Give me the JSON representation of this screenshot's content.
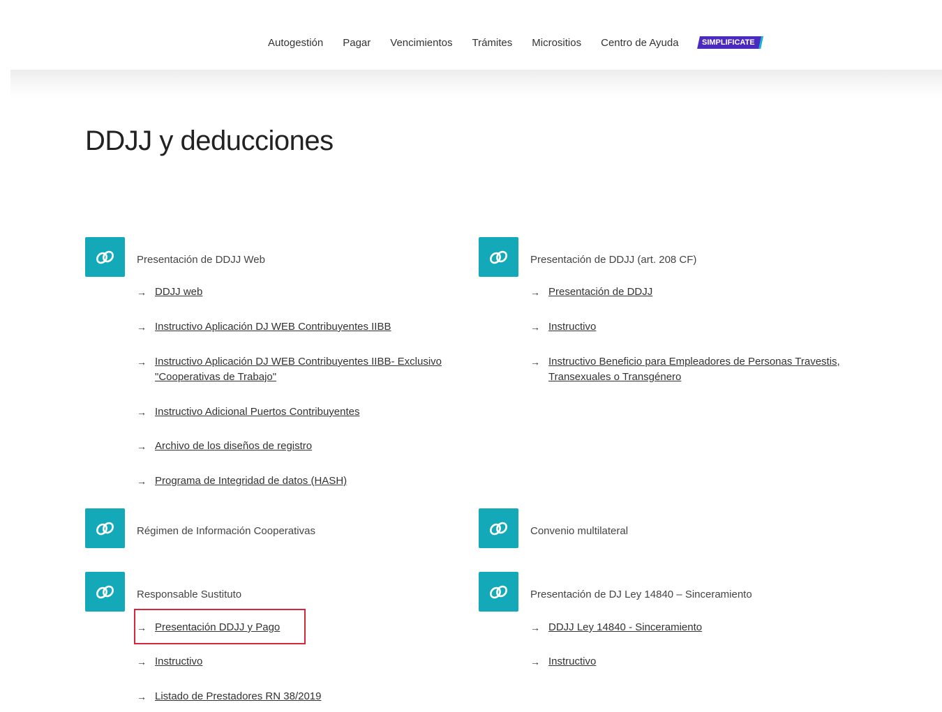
{
  "nav": {
    "items": [
      "Autogestión",
      "Pagar",
      "Vencimientos",
      "Trámites",
      "Micrositios",
      "Centro de Ayuda"
    ],
    "badge": "SIMPLIFICATE"
  },
  "page": {
    "title": "DDJJ y deducciones"
  },
  "sections": [
    {
      "title": "Presentación de DDJJ Web",
      "icon": "link-icon",
      "links": [
        [
          "DDJJ web"
        ],
        [
          "Instructivo Aplicación DJ WEB Contribuyentes IIBB"
        ],
        [
          "Instructivo Aplicación DJ WEB Contribuyentes IIBB- Exclusivo",
          "\"Cooperativas de Trabajo\""
        ],
        [
          "Instructivo Adicional Puertos Contribuyentes"
        ],
        [
          "Archivo de los diseños de registro"
        ],
        [
          "Programa de Integridad de datos (HASH)"
        ]
      ]
    },
    {
      "title": "Presentación de DDJJ (art. 208 CF)",
      "icon": "link-icon",
      "links": [
        [
          "Presentación de DDJJ"
        ],
        [
          "Instructivo"
        ],
        [
          "Instructivo Beneficio para Empleadores de Personas Travestis,",
          "Transexuales o Transgénero"
        ]
      ]
    },
    {
      "title": "Régimen de Información Cooperativas",
      "icon": "link-icon",
      "links": []
    },
    {
      "title": "Convenio multilateral",
      "icon": "link-icon",
      "links": []
    },
    {
      "title": "Responsable Sustituto",
      "icon": "link-icon",
      "links": [
        [
          "Presentación DDJJ y Pago"
        ],
        [
          "Instructivo"
        ],
        [
          "Listado de Prestadores RN 38/2019"
        ]
      ]
    },
    {
      "title": "Presentación de DJ Ley 14840 – Sinceramiento",
      "icon": "link-icon",
      "links": [
        [
          "DDJJ Ley 14840 - Sinceramiento"
        ],
        [
          "Instructivo"
        ]
      ]
    }
  ],
  "arrow_glyph": "→",
  "colors": {
    "icon_bg": "#14a9b9",
    "badge_bg": "#4b2bbd",
    "highlight": "#d6263b"
  }
}
